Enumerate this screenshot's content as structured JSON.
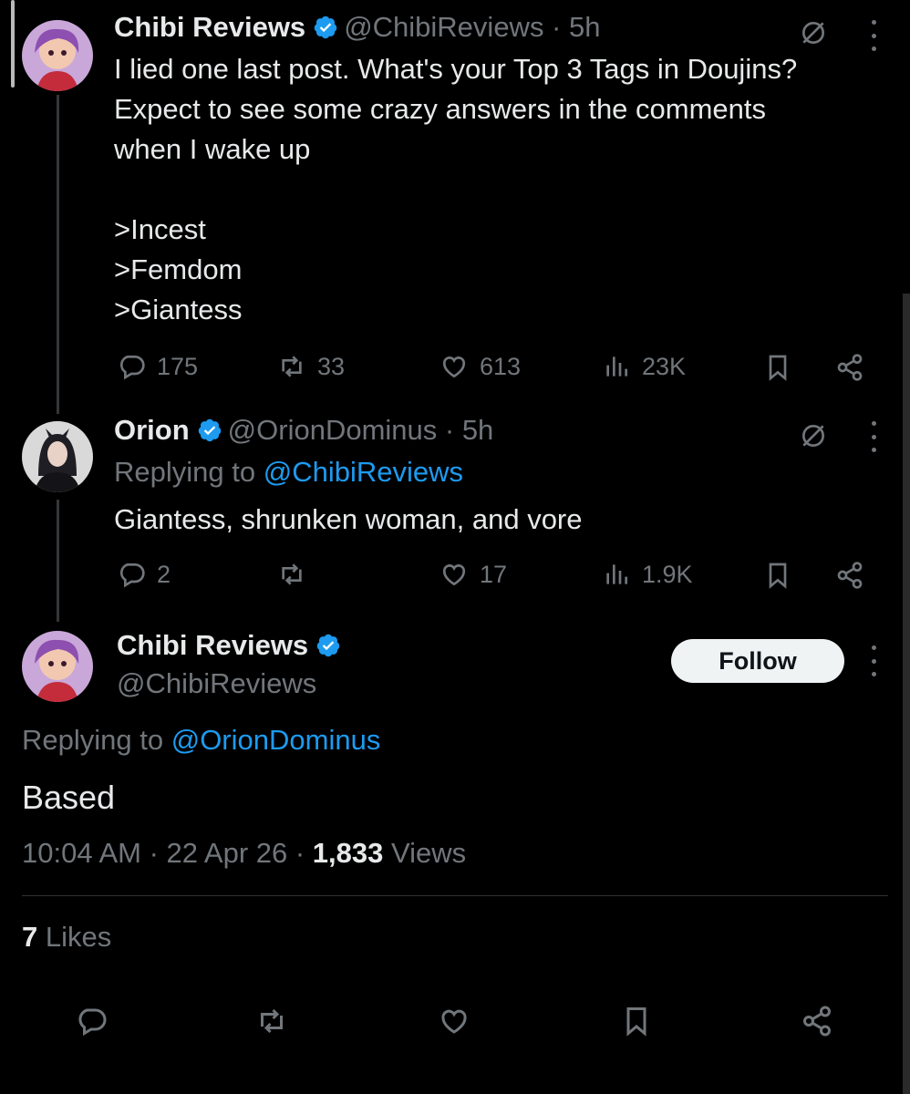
{
  "post1": {
    "name": "Chibi Reviews",
    "handle_time": "@ChibiReviews · 5h",
    "text": "I lied one last post. What's your Top 3 Tags in Doujins?\nExpect to see some crazy answers in the comments\nwhen I wake up\n\n>Incest\n>Femdom\n>Giantess",
    "replies": "175",
    "reposts": "33",
    "likes": "613",
    "views": "23K"
  },
  "post2": {
    "name": "Orion",
    "handle_time": "@OrionDominus · 5h",
    "replying_prefix": "Replying to",
    "replying_to": "@ChibiReviews",
    "text": "Giantess, shrunken woman, and vore",
    "replies": "2",
    "likes": "17",
    "views": "1.9K"
  },
  "main": {
    "name": "Chibi Reviews",
    "handle": "@ChibiReviews",
    "follow_label": "Follow",
    "replying_prefix": "Replying to",
    "replying_to": "@OrionDominus",
    "text": "Based",
    "timestamp": "10:04 AM · 22 Apr 26 · ",
    "views_count": "1,833",
    "views_label": " Views",
    "likes_count": "7",
    "likes_label": " Likes"
  },
  "colors": {
    "background": "#000000",
    "text": "#e7e9ea",
    "muted": "#71767b",
    "link": "#1d9bf0",
    "verified": "#1d9bf0"
  },
  "icons": [
    "verified-badge-icon",
    "grok-icon",
    "more-icon",
    "reply-icon",
    "repost-icon",
    "like-icon",
    "views-icon",
    "bookmark-icon",
    "share-icon"
  ]
}
